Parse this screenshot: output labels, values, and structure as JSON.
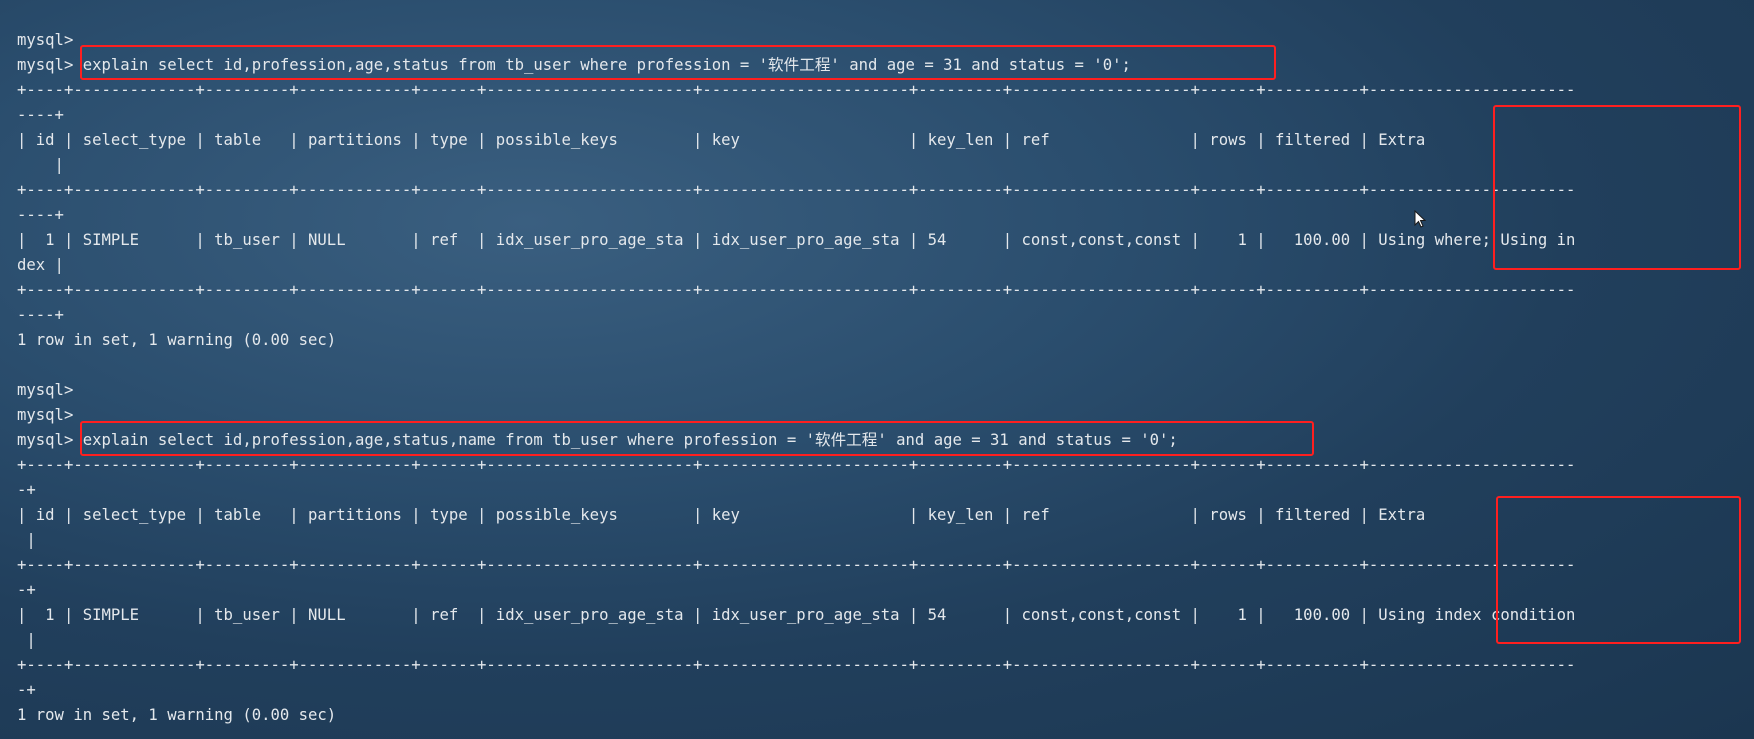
{
  "terminal": {
    "lines": [
      "mysql>",
      "mysql> explain select id,profession,age,status from tb_user where profession = '软件工程' and age = 31 and status = '0';",
      "+----+-------------+---------+------------+------+----------------------+----------------------+---------+-------------------+------+----------+----------------------",
      "----+",
      "| id | select_type | table   | partitions | type | possible_keys        | key                  | key_len | ref               | rows | filtered | Extra",
      "    |",
      "+----+-------------+---------+------------+------+----------------------+----------------------+---------+-------------------+------+----------+----------------------",
      "----+",
      "|  1 | SIMPLE      | tb_user | NULL       | ref  | idx_user_pro_age_sta | idx_user_pro_age_sta | 54      | const,const,const |    1 |   100.00 | Using where; Using in",
      "dex |",
      "+----+-------------+---------+------------+------+----------------------+----------------------+---------+-------------------+------+----------+----------------------",
      "----+",
      "1 row in set, 1 warning (0.00 sec)",
      "",
      "mysql>",
      "mysql>",
      "mysql> explain select id,profession,age,status,name from tb_user where profession = '软件工程' and age = 31 and status = '0';",
      "+----+-------------+---------+------------+------+----------------------+----------------------+---------+-------------------+------+----------+----------------------",
      "-+",
      "| id | select_type | table   | partitions | type | possible_keys        | key                  | key_len | ref               | rows | filtered | Extra",
      " |",
      "+----+-------------+---------+------------+------+----------------------+----------------------+---------+-------------------+------+----------+----------------------",
      "-+",
      "|  1 | SIMPLE      | tb_user | NULL       | ref  | idx_user_pro_age_sta | idx_user_pro_age_sta | 54      | const,const,const |    1 |   100.00 | Using index condition",
      " |",
      "+----+-------------+---------+------------+------+----------------------+----------------------+---------+-------------------+------+----------+----------------------",
      "-+",
      "1 row in set, 1 warning (0.00 sec)"
    ]
  },
  "colors": {
    "text": "#e4e8ec",
    "highlight_box": "#ff1f1f",
    "background": "#2a4d6d"
  },
  "icons": {
    "cursor": "mouse-pointer-icon"
  }
}
